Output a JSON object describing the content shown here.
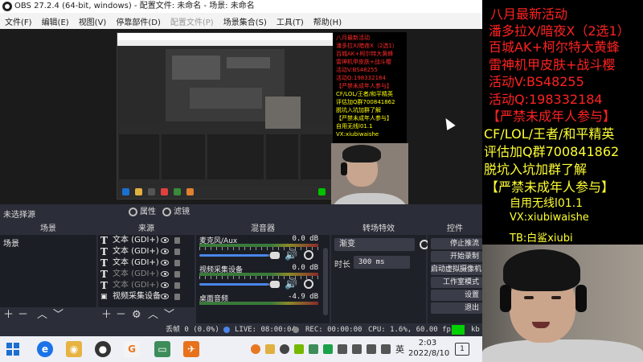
{
  "window": {
    "title": "OBS 27.2.4 (64-bit, windows) - 配置文件: 未命名 - 场景: 未命名"
  },
  "menu": {
    "items": [
      "文件(F)",
      "编辑(E)",
      "视图(V)",
      "停靠部件(D)",
      "配置文件(P)",
      "场景集合(S)",
      "工具(T)",
      "帮助(H)"
    ]
  },
  "promo": {
    "lines": [
      {
        "text": "八月最新活动",
        "color": "#ff2222"
      },
      {
        "text": "潘多拉X/暗夜X（2选1）",
        "color": "#ff2222"
      },
      {
        "text": "百城AK+柯尔特大黄蜂",
        "color": "#ff2222"
      },
      {
        "text": "雷神机甲皮肤+战斗樱",
        "color": "#ff2222"
      },
      {
        "text": "活动V:BS48255",
        "color": "#ff2222"
      },
      {
        "text": "活动Q:198332184",
        "color": "#ff2222"
      },
      {
        "text": "【严禁未成年人参与】",
        "color": "#ff2222"
      },
      {
        "text": "CF/LOL/王者/和平精英",
        "color": "#ffff33"
      },
      {
        "text": "评估加Q群700841862",
        "color": "#ffff33"
      },
      {
        "text": "脱坑入坑加群了解",
        "color": "#ffff33"
      },
      {
        "text": "【严禁未成年人参与】",
        "color": "#ffff33"
      },
      {
        "text": "自用无线l01.1",
        "color": "#ffff33"
      },
      {
        "text": "VX:xiubiwaishe",
        "color": "#ffff33"
      },
      {
        "text": "TB:白鲨xiubi",
        "color": "#ffff33"
      }
    ]
  },
  "selection": {
    "label": "未选择源",
    "props": "属性",
    "filters": "滤镜"
  },
  "docks": {
    "scenes": {
      "title": "场景",
      "items": [
        "场景"
      ]
    },
    "sources": {
      "title": "来源",
      "items": [
        {
          "label": "文本 (GDI+)",
          "icon": "T"
        },
        {
          "label": "文本 (GDI+)",
          "icon": "T"
        },
        {
          "label": "文本 (GDI+)",
          "icon": "T"
        },
        {
          "label": "文本 (GDI+)",
          "icon": "T"
        },
        {
          "label": "文本 (GDI+)",
          "icon": "T"
        },
        {
          "label": "视频采集设备",
          "icon": "cam"
        }
      ]
    },
    "mixer": {
      "title": "混音器",
      "channels": [
        {
          "name": "麦克风/Aux",
          "db": "0.0 dB"
        },
        {
          "name": "视频采集设备",
          "db": "0.0 dB"
        },
        {
          "name": "桌面音频",
          "db": "-4.9 dB"
        }
      ]
    },
    "transitions": {
      "title": "转场特效",
      "type": "渐变",
      "duration_label": "时长",
      "duration": "300 ms"
    },
    "controls": {
      "title": "控件",
      "buttons": [
        "停止推流",
        "开始录制",
        "启动虚拟摄像机",
        "工作室模式",
        "设置",
        "退出"
      ]
    }
  },
  "status": {
    "dropped": "丢帧 0 (0.0%)",
    "live": "LIVE: 08:00:04",
    "rec": "REC: 00:00:00",
    "cpu": "CPU: 1.6%, 60.00 fps",
    "kbps": "kb"
  },
  "taskbar": {
    "time": "2:03",
    "date": "2022/8/10",
    "ime": "英",
    "notif": "1",
    "colors": {
      "accent": "#1b6fd1"
    }
  }
}
